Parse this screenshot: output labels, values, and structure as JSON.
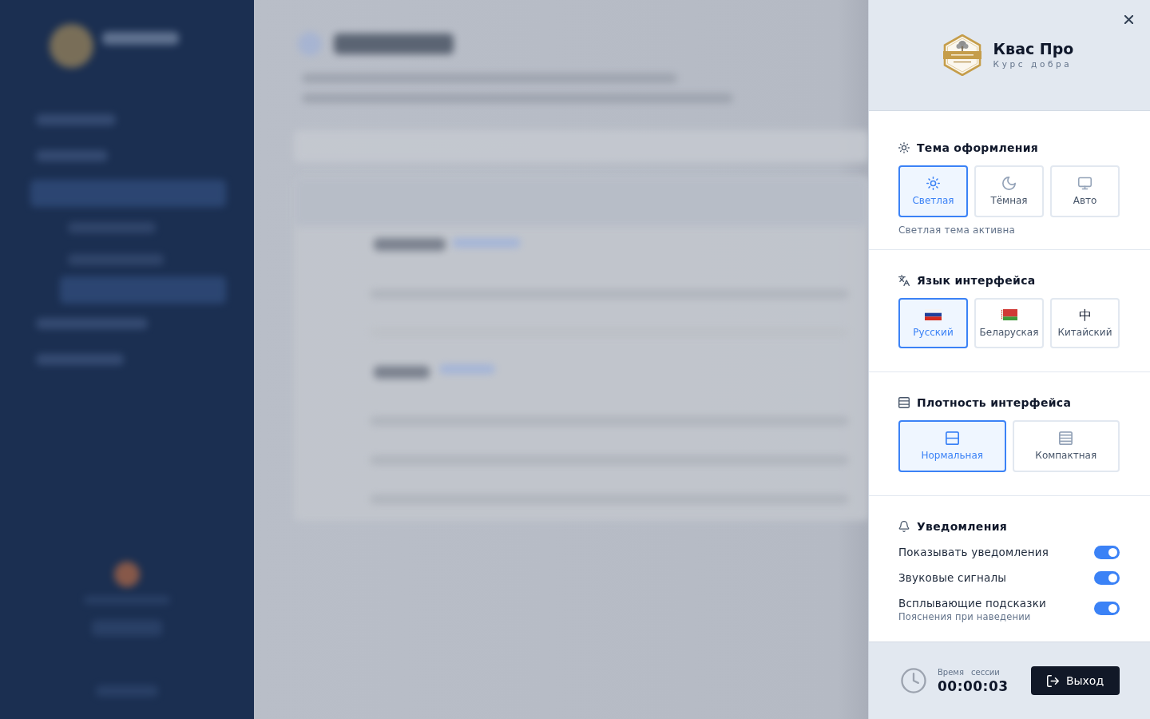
{
  "settings_panel": {
    "header": {
      "title": "Квас Про",
      "subtitle": "Курс добра"
    },
    "theme": {
      "heading": "Тема оформления",
      "options": [
        {
          "label": "Светлая",
          "kind": "light",
          "selected": true
        },
        {
          "label": "Тёмная",
          "kind": "dark",
          "selected": false
        },
        {
          "label": "Авто",
          "kind": "auto",
          "selected": false
        }
      ],
      "caption": "Светлая тема активна"
    },
    "language": {
      "heading": "Язык интерфейса",
      "options": [
        {
          "label": "Русский",
          "kind": "russian",
          "selected": true
        },
        {
          "label": "Беларуская",
          "kind": "belarusian",
          "selected": false
        },
        {
          "label": "Китайский",
          "kind": "chinese",
          "glyph": "中",
          "selected": false
        }
      ]
    },
    "density": {
      "heading": "Плотность интерфейса",
      "options": [
        {
          "label": "Нормальная",
          "kind": "normal",
          "selected": true
        },
        {
          "label": "Компактная",
          "kind": "compact",
          "selected": false
        }
      ]
    },
    "notifications": {
      "heading": "Уведомления",
      "items": [
        {
          "label": "Показывать уведомления",
          "on": true
        },
        {
          "label": "Звуковые сигналы",
          "on": true
        },
        {
          "label": "Всплывающие подсказки",
          "hint": "Пояснения при наведении",
          "on": true
        }
      ]
    },
    "footer": {
      "session_label": "Время сессии",
      "session_time": "00:00:03",
      "logout": "Выход"
    }
  }
}
